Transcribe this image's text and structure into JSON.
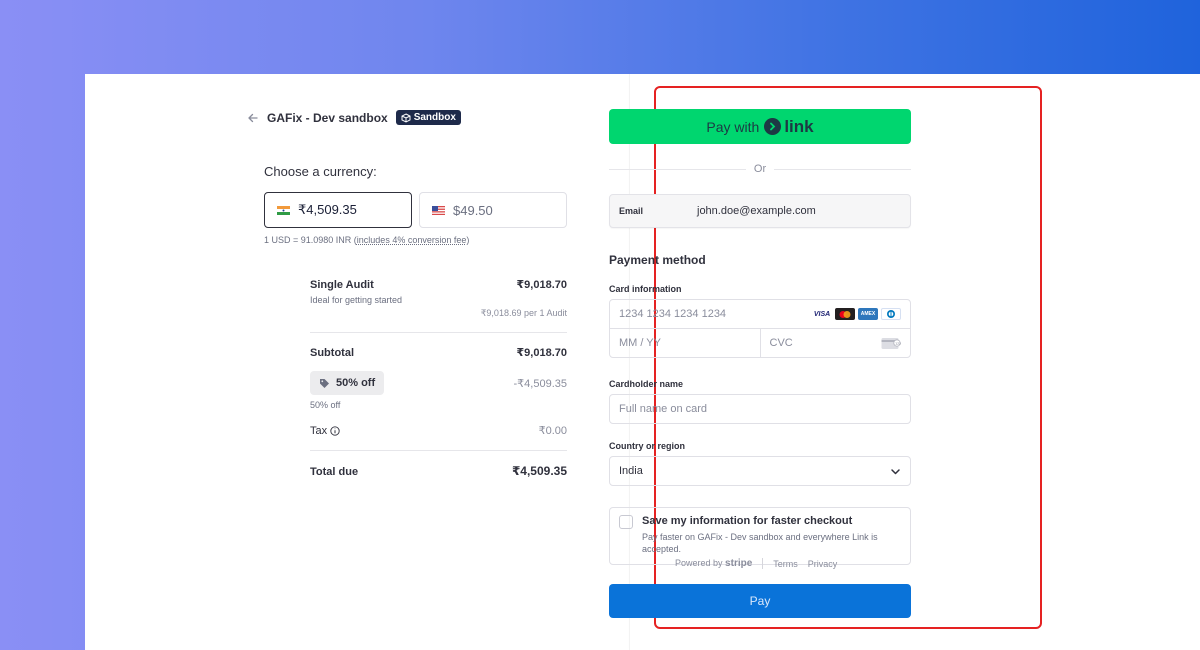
{
  "merchant": {
    "name": "GAFix - Dev sandbox",
    "badge": "Sandbox"
  },
  "currency": {
    "title": "Choose a currency:",
    "options": [
      {
        "amount": "₹4,509.35",
        "selected": true
      },
      {
        "amount": "$49.50",
        "selected": false
      }
    ],
    "fx_note_prefix": "1 USD = 91.0980 INR (",
    "fx_note_link": "includes 4% conversion fee",
    "fx_note_suffix": ")"
  },
  "summary": {
    "item": {
      "name": "Single Audit",
      "price": "₹9,018.70",
      "desc": "Ideal for getting started",
      "unit": "₹9,018.69 per 1 Audit"
    },
    "subtotal": {
      "label": "Subtotal",
      "value": "₹9,018.70"
    },
    "promo": {
      "label": "50% off",
      "value": "-₹4,509.35",
      "desc": "50% off"
    },
    "tax": {
      "label": "Tax",
      "value": "₹0.00"
    },
    "total": {
      "label": "Total due",
      "value": "₹4,509.35"
    }
  },
  "payment": {
    "link_button_prefix": "Pay with",
    "link_button_brand": "link",
    "or": "Or",
    "email_label": "Email",
    "email_value": "john.doe@example.com",
    "section_title": "Payment method",
    "card_label": "Card information",
    "card_placeholder": "1234 1234 1234 1234",
    "expiry_placeholder": "MM / YY",
    "cvc_placeholder": "CVC",
    "cardholder_label": "Cardholder name",
    "cardholder_placeholder": "Full name on card",
    "country_label": "Country or region",
    "country_value": "India",
    "save_title": "Save my information for faster checkout",
    "save_desc": "Pay faster on GAFix - Dev sandbox and everywhere Link is accepted.",
    "pay_button": "Pay",
    "brands": [
      "VISA",
      "mastercard",
      "amex",
      "diners"
    ]
  },
  "footer": {
    "powered_by": "Powered by",
    "stripe": "stripe",
    "terms": "Terms",
    "privacy": "Privacy"
  },
  "colors": {
    "link_green": "#00d66f",
    "pay_blue": "#0a73d9",
    "highlight_red": "#e52222",
    "badge_navy": "#1e2a4a"
  }
}
